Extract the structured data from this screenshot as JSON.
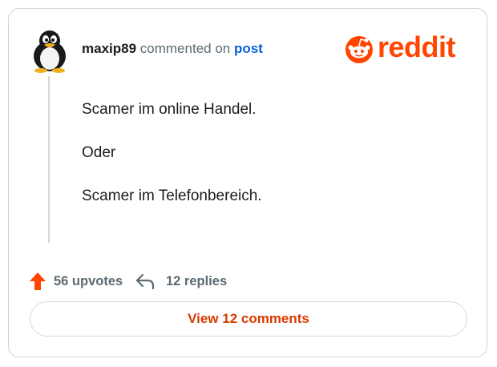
{
  "comment": {
    "username": "maxip89",
    "action_text": "commented on",
    "link_text": "post",
    "body": [
      "Scamer im online Handel.",
      "Oder",
      "Scamer im Telefonbereich."
    ]
  },
  "brand": {
    "logo_text": "reddit",
    "color": "#ff4500"
  },
  "stats": {
    "upvotes": "56 upvotes",
    "replies": "12 replies"
  },
  "footer": {
    "view_comments_label": "View 12 comments"
  },
  "icons": {
    "avatar": "penguin-avatar",
    "upvote": "upvote-arrow-icon",
    "reply": "reply-arrow-icon",
    "logo": "reddit-snoo-icon"
  }
}
